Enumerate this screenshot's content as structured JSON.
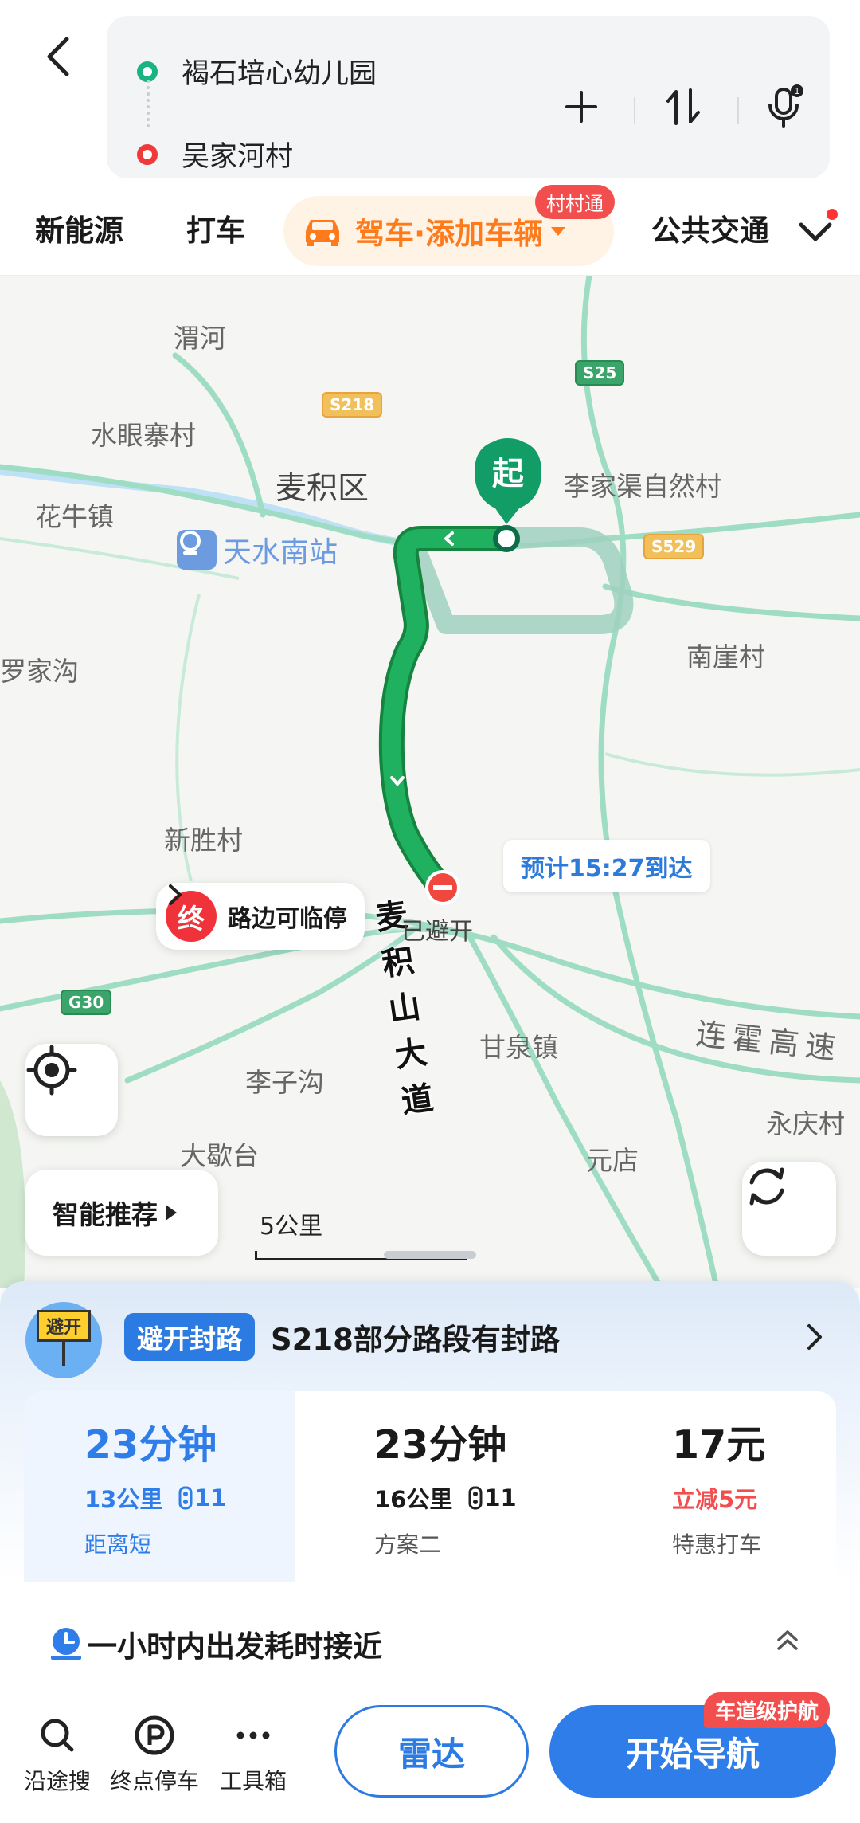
{
  "search": {
    "origin": "褐石培心幼儿园",
    "destination": "吴家河村"
  },
  "tabs": {
    "new_energy": "新能源",
    "taxi": "打车",
    "drive": "驾车·添加车辆",
    "drive_badge": "村村通",
    "transit": "公共交通"
  },
  "map": {
    "places": {
      "weihe": "渭河",
      "shuiyanzhai": "水眼寨村",
      "maiji": "麦积区",
      "huaniu": "花牛镇",
      "tianshui_south": "天水南站",
      "lijiaqu": "李家渠自然村",
      "nanya": "南崖村",
      "luojiagou": "罗家沟",
      "xinsheng": "新胜村",
      "ganquan": "甘泉镇",
      "lizigou": "李子沟",
      "yongqing": "永庆村",
      "dalitai": "大歇台",
      "yuandian": "元店",
      "lianhuo": "连霍高速"
    },
    "shields": {
      "s218": "S218",
      "s25": "S25",
      "s529": "S529",
      "g30": "G30"
    },
    "start_marker": "起",
    "end_marker": "终",
    "end_label": "路边可临停",
    "road_name": "麦积山大道",
    "avoided": "已避开",
    "eta": "预计15:27到达",
    "smart_btn": "智能推荐",
    "scale": "5公里"
  },
  "sheet": {
    "notice_icon": "避开",
    "notice_tag": "避开封路",
    "notice_text": "S218部分路段有封路",
    "routes": [
      {
        "time": "23分钟",
        "distance": "13公里",
        "lights": "11",
        "desc": "距离短"
      },
      {
        "time": "23分钟",
        "distance": "16公里",
        "lights": "11",
        "desc": "方案二"
      },
      {
        "time": "17元",
        "distance": "立减5元",
        "desc": "特惠打车"
      }
    ],
    "hint": "一小时内出发耗时接近"
  },
  "actions": {
    "along_search": "沿途搜",
    "parking": "终点停车",
    "toolbox": "工具箱",
    "radar": "雷达",
    "start_nav": "开始导航",
    "lane_badge": "车道级护航"
  },
  "colors": {
    "route_green": "#1aa561",
    "accent_blue": "#2f7de8",
    "drive_orange": "#ff7a1a",
    "alert_red": "#f34e4e"
  }
}
